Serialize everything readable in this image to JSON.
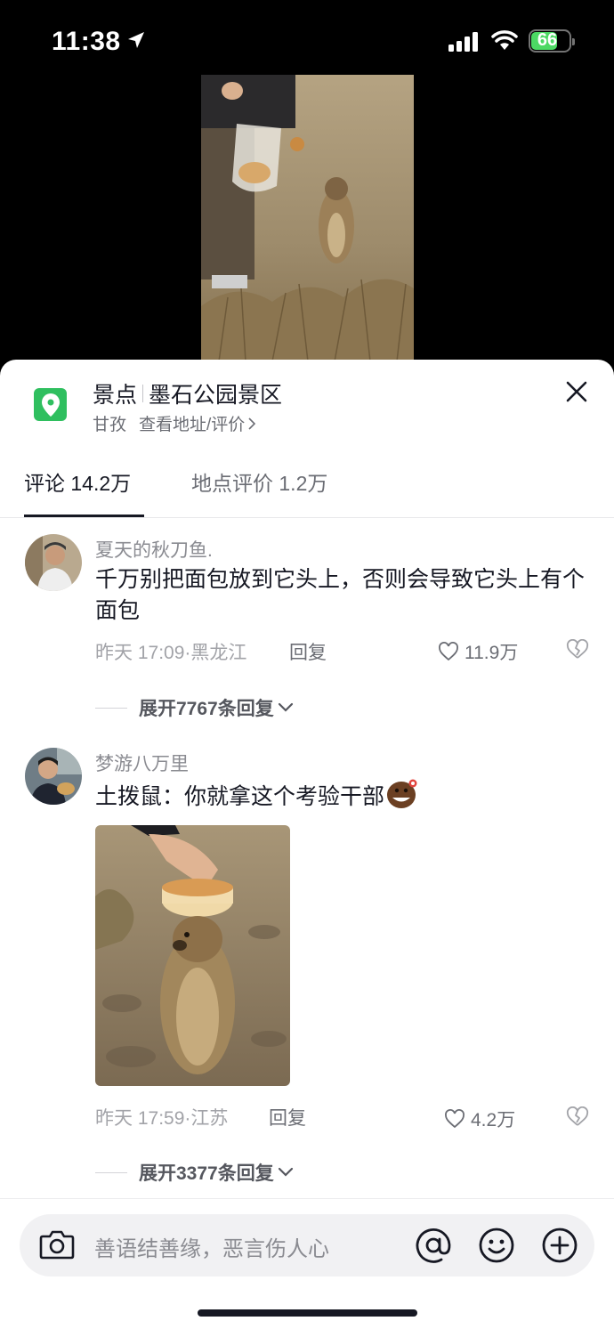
{
  "status_bar": {
    "time": "11:38",
    "battery": "66"
  },
  "poi": {
    "category": "景点",
    "name": "墨石公园景区",
    "region": "甘孜",
    "link": "查看地址/评价"
  },
  "tabs": [
    {
      "label": "评论 14.2万",
      "active": true
    },
    {
      "label": "地点评价 1.2万",
      "active": false
    }
  ],
  "comments": [
    {
      "username": "夏天的秋刀鱼.",
      "text": "千万别把面包放到它头上，否则会导致它头上有个面包",
      "meta": "昨天 17:09·黑龙江",
      "reply_label": "回复",
      "likes": "11.9万",
      "expand": "展开7767条回复"
    },
    {
      "username": "梦游八万里",
      "text": "土拨鼠：你就拿这个考验干部",
      "meta": "昨天 17:59·江苏",
      "reply_label": "回复",
      "likes": "4.2万",
      "expand": "展开3377条回复"
    }
  ],
  "input": {
    "placeholder": "善语结善缘，恶言伤人心"
  },
  "colors": {
    "accent_green": "#2fbf5f",
    "battery_green": "#4cd964",
    "text_primary": "#161823"
  },
  "icons": [
    "location-arrow-icon",
    "signal-icon",
    "wifi-icon",
    "battery-icon",
    "map-pin-icon",
    "close-icon",
    "heart-icon",
    "broken-heart-icon",
    "chevron-down-icon",
    "camera-icon",
    "at-icon",
    "emoji-icon",
    "plus-icon"
  ]
}
